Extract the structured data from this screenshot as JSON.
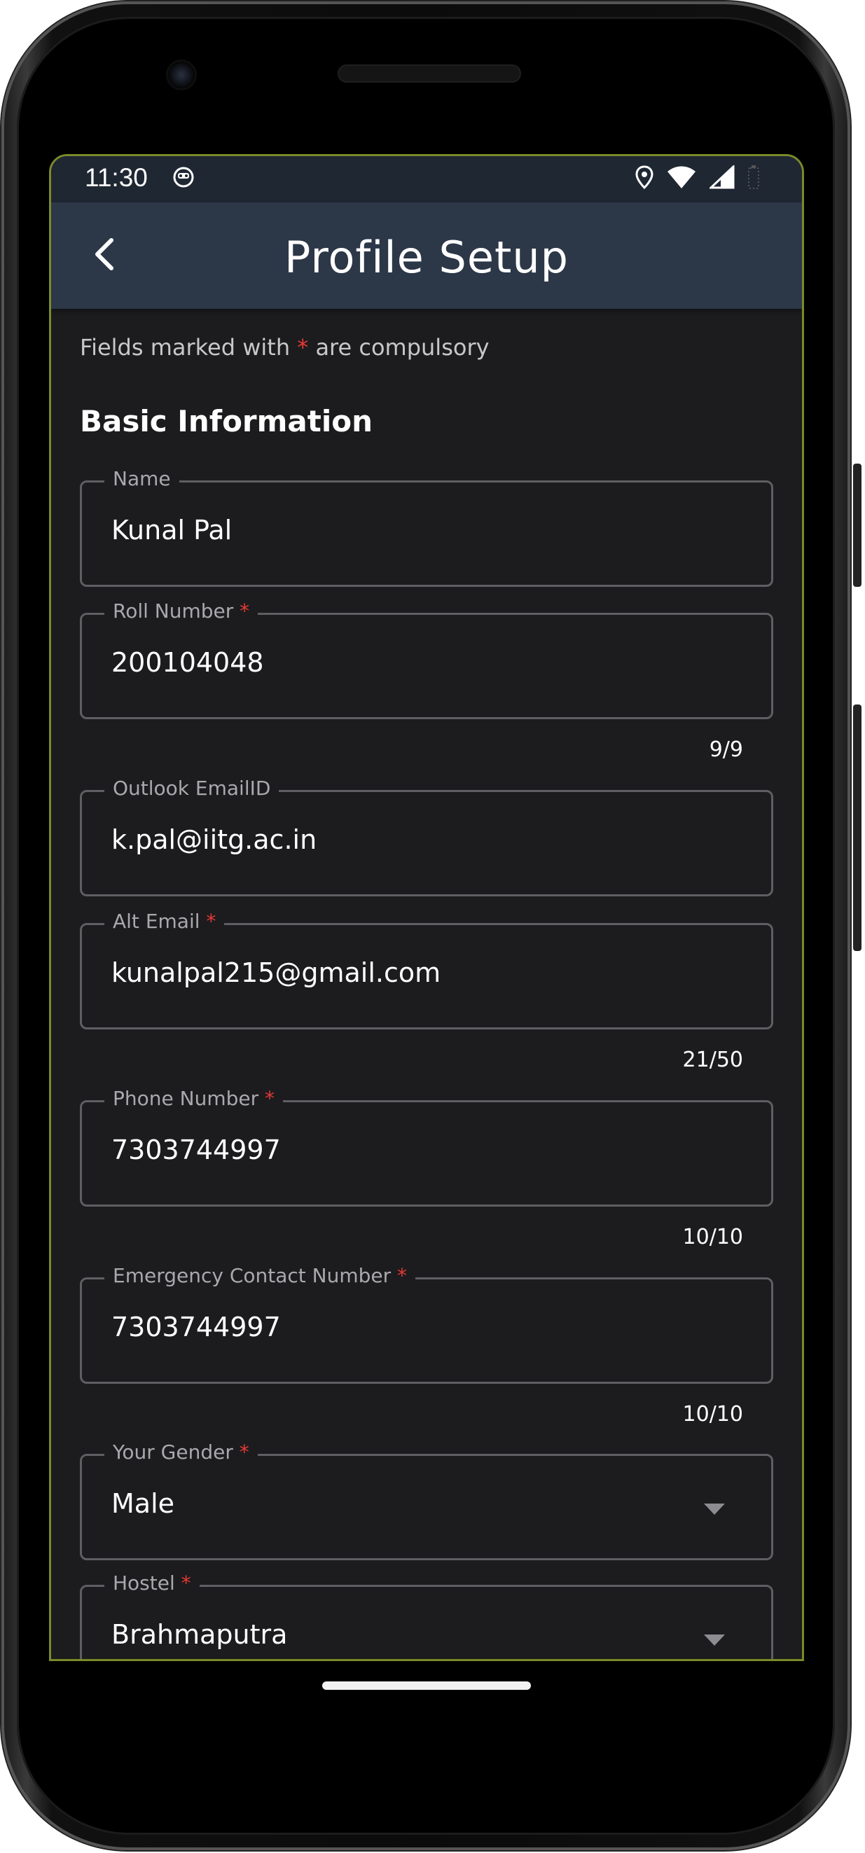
{
  "status_bar": {
    "time": "11:30"
  },
  "app_bar": {
    "title": "Profile Setup"
  },
  "hint": {
    "prefix": "Fields marked with ",
    "star": "*",
    "suffix": " are compulsory"
  },
  "section": {
    "title": "Basic Information"
  },
  "fields": [
    {
      "label": "Name",
      "required": false,
      "value": "Kunal Pal",
      "counter": ""
    },
    {
      "label": "Roll Number",
      "required": true,
      "value": "200104048",
      "counter": "9/9"
    },
    {
      "label": "Outlook EmailID",
      "required": false,
      "value": "k.pal@iitg.ac.in",
      "counter": ""
    },
    {
      "label": "Alt Email",
      "required": true,
      "value": "kunalpal215@gmail.com",
      "counter": "21/50"
    },
    {
      "label": "Phone Number",
      "required": true,
      "value": "7303744997",
      "counter": "10/10"
    },
    {
      "label": "Emergency Contact Number",
      "required": true,
      "value": "7303744997",
      "counter": "10/10"
    }
  ],
  "dropdowns": [
    {
      "label": "Your Gender",
      "required": true,
      "value": "Male"
    },
    {
      "label": "Hostel",
      "required": true,
      "value": "Brahmaputra"
    }
  ],
  "required_marker": "*",
  "colors": {
    "status_bar_bg": "#1f2733",
    "app_bar_bg": "#2c3748",
    "screen_bg": "#1c1c1e",
    "required": "#e53935",
    "field_border": "#5f5f63"
  }
}
